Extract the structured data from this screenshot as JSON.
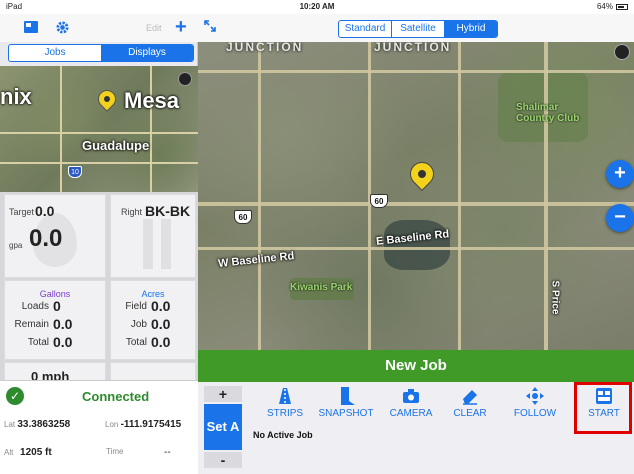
{
  "status_bar": {
    "device": "iPad",
    "time": "10:20 AM",
    "battery": "64%"
  },
  "left_toolbar": {
    "edit_label": "Edit",
    "add_label": "+"
  },
  "left_tabs": {
    "jobs": "Jobs",
    "displays": "Displays"
  },
  "mini_map": {
    "label_mix": "nix",
    "label_mesa": "Mesa",
    "label_guadalupe": "Guadalupe",
    "route": "10"
  },
  "gauges": {
    "target_label": "Target",
    "target_value": "0.0",
    "rate_value": "0.0",
    "rate_unit": "gpa",
    "right_label": "Right",
    "right_value": "BK-BK",
    "gallons_title": "Gallons",
    "acres_title": "Acres",
    "loads_label": "Loads",
    "loads_value": "0",
    "remain_label": "Remain",
    "remain_value": "0.0",
    "gal_total_label": "Total",
    "gal_total_value": "0.0",
    "field_label": "Field",
    "field_value": "0.0",
    "job_label": "Job",
    "job_value": "0.0",
    "acre_total_label": "Total",
    "acre_total_value": "0.0",
    "speed_value": "0 mph"
  },
  "connection": {
    "status": "Connected",
    "lat_label": "Lat",
    "lat_value": "33.3863258",
    "lon_label": "Lon",
    "lon_value": "-111.9175415",
    "alt_label": "Alt",
    "alt_value": "1205 ft",
    "time_label": "Time",
    "time_value": "--"
  },
  "map_types": {
    "standard": "Standard",
    "satellite": "Satellite",
    "hybrid": "Hybrid",
    "selected": "Hybrid"
  },
  "map": {
    "top_label_1": "JUNCTION",
    "top_label_2": "JUNCTION",
    "club_label": "Shalimar Country Club",
    "street_1": "E Baseline Rd",
    "street_2": "W Baseline Rd",
    "park_label": "Kiwanis Park",
    "side_street": "S Price",
    "route_a": "60",
    "route_b": "60",
    "zoom_in": "+",
    "zoom_out": "−"
  },
  "new_job_label": "New Job",
  "bottom_bar": {
    "plus": "+",
    "minus": "-",
    "set_a": "Set A",
    "no_active_job": "No Active Job",
    "tools": [
      "STRIPS",
      "SNAPSHOT",
      "CAMERA",
      "CLEAR",
      "FOLLOW",
      "START"
    ]
  },
  "colors": {
    "accent": "#1a73e8",
    "green": "#3f9a28",
    "highlight": "#e00000"
  }
}
